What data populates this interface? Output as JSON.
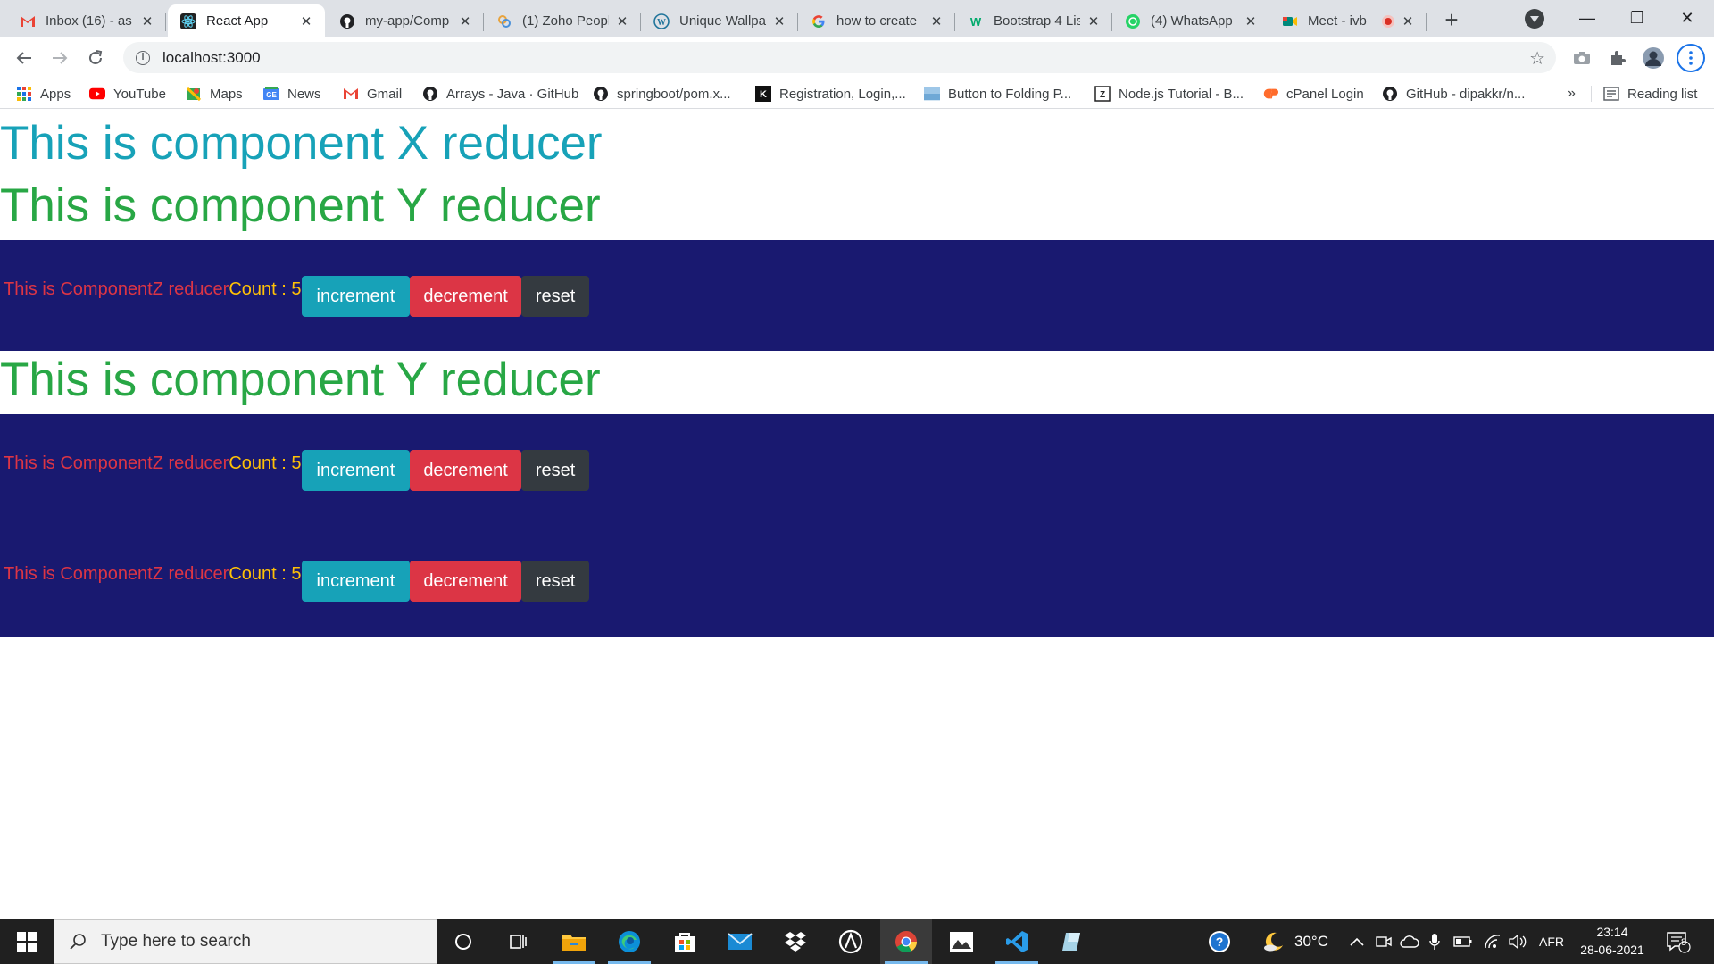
{
  "browser": {
    "tabs": [
      {
        "title": "Inbox (16) - as",
        "icon": "gmail-icon"
      },
      {
        "title": "React App",
        "icon": "react-icon",
        "active": true
      },
      {
        "title": "my-app/Comp",
        "icon": "github-icon"
      },
      {
        "title": "(1) Zoho Peopl",
        "icon": "zoho-icon"
      },
      {
        "title": "Unique Wallpa",
        "icon": "wordpress-icon"
      },
      {
        "title": "how to create",
        "icon": "google-icon"
      },
      {
        "title": "Bootstrap 4 Lis",
        "icon": "w3-icon"
      },
      {
        "title": "(4) WhatsApp",
        "icon": "whatsapp-icon"
      },
      {
        "title": "Meet - ivb",
        "icon": "meet-icon"
      }
    ],
    "new_tab_symbol": "+",
    "window_controls": {
      "minimize": "—",
      "maximize": "❐",
      "close": "✕"
    },
    "url": "localhost:3000",
    "bookmarks": [
      {
        "label": "Apps",
        "icon": "apps-icon"
      },
      {
        "label": "YouTube",
        "icon": "youtube-icon"
      },
      {
        "label": "Maps",
        "icon": "maps-icon"
      },
      {
        "label": "News",
        "icon": "news-icon"
      },
      {
        "label": "Gmail",
        "icon": "gmail-icon"
      },
      {
        "label": "Arrays - Java · GitHub",
        "icon": "github-icon"
      },
      {
        "label": "springboot/pom.x...",
        "icon": "github-icon"
      },
      {
        "label": "Registration, Login,...",
        "icon": "k-icon"
      },
      {
        "label": "Button to Folding P...",
        "icon": "image-icon"
      },
      {
        "label": "Node.js Tutorial - B...",
        "icon": "nodejs-icon"
      },
      {
        "label": "cPanel Login",
        "icon": "cpanel-icon"
      },
      {
        "label": "GitHub - dipakkr/n...",
        "icon": "github-icon"
      }
    ],
    "bookmarks_overflow": "»",
    "reading_list": "Reading list"
  },
  "page": {
    "heading_x": "This is component X reducer",
    "heading_y_1": "This is component Y reducer",
    "heading_y_2": "This is component Y reducer",
    "z_rows": [
      {
        "label": "This is ComponentZ reducer",
        "count_text": "Count : 5",
        "increment": "increment",
        "decrement": "decrement",
        "reset": "reset"
      },
      {
        "label": "This is ComponentZ reducer",
        "count_text": "Count : 5",
        "increment": "increment",
        "decrement": "decrement",
        "reset": "reset"
      },
      {
        "label": "This is ComponentZ reducer",
        "count_text": "Count : 5",
        "increment": "increment",
        "decrement": "decrement",
        "reset": "reset"
      }
    ],
    "colors": {
      "heading_x": "#17a2b8",
      "heading_y": "#28a745",
      "panel_bg": "#191970",
      "z_label": "#dc3545",
      "count": "#ffc107",
      "btn_increment": "#17a2b8",
      "btn_decrement": "#dc3545",
      "btn_reset": "#343a40"
    }
  },
  "taskbar": {
    "search_placeholder": "Type here to search",
    "pinned_apps": [
      "cortana-icon",
      "task-view-icon",
      "file-explorer-icon",
      "edge-icon",
      "store-icon",
      "mail-icon",
      "dropbox-icon",
      "app-icon",
      "chrome-icon",
      "photos-icon",
      "vscode-icon",
      "app-icon"
    ],
    "active_app": "chrome-icon",
    "temperature": "30°C",
    "language": "AFR",
    "time": "23:14",
    "date": "28-06-2021",
    "notification_count": "8"
  }
}
